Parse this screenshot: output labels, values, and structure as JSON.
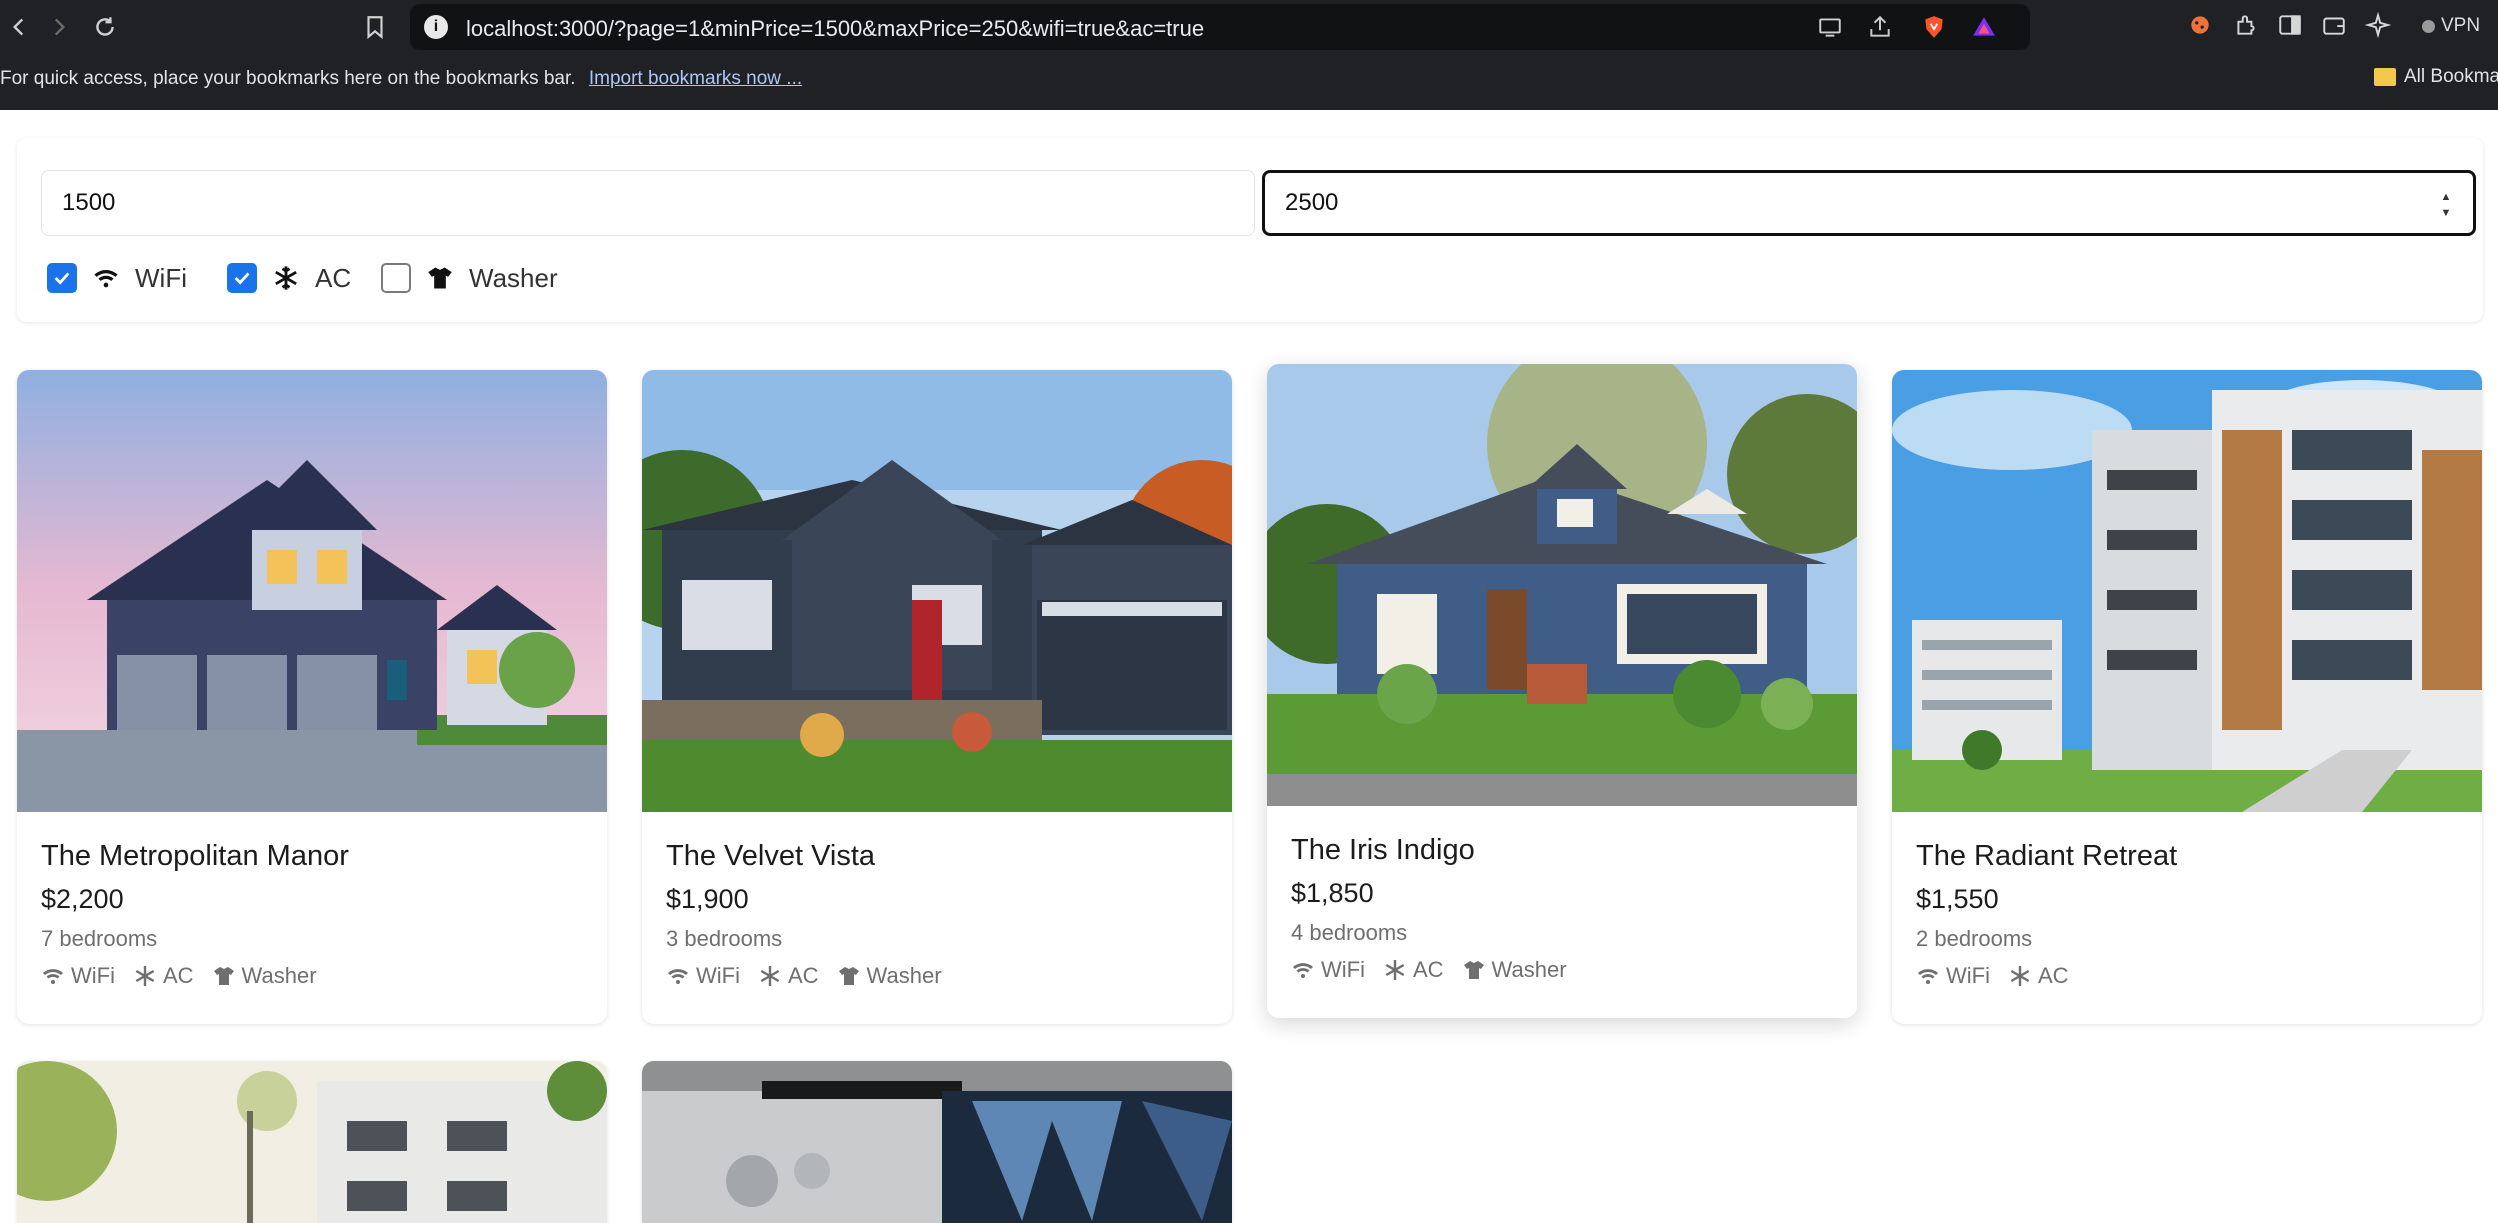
{
  "browser": {
    "url": "localhost:3000/?page=1&minPrice=1500&maxPrice=250&wifi=true&ac=true",
    "vpn_label": "VPN",
    "bookmarks_prompt": "For quick access, place your bookmarks here on the bookmarks bar.",
    "import_link": "Import bookmarks now ...",
    "all_bookmarks": "All Bookma"
  },
  "filters": {
    "min_price": "1500",
    "max_price": "2500",
    "amenities": [
      {
        "label": "WiFi",
        "checked": true,
        "icon": "wifi-icon"
      },
      {
        "label": "AC",
        "checked": true,
        "icon": "snowflake-icon"
      },
      {
        "label": "Washer",
        "checked": false,
        "icon": "shirt-icon"
      }
    ]
  },
  "listings": [
    {
      "title": "The Metropolitan Manor",
      "price": "$2,200",
      "bedrooms": "7 bedrooms",
      "amenities": [
        "WiFi",
        "AC",
        "Washer"
      ],
      "image": "navy two-story house with three-car garage at dusk"
    },
    {
      "title": "The Velvet Vista",
      "price": "$1,900",
      "bedrooms": "3 bedrooms",
      "amenities": [
        "WiFi",
        "AC",
        "Washer"
      ],
      "image": "dark ranch house with red door and garden"
    },
    {
      "title": "The Iris Indigo",
      "price": "$1,850",
      "bedrooms": "4 bedrooms",
      "amenities": [
        "WiFi",
        "AC",
        "Washer"
      ],
      "image": "blue craftsman bungalow with lush front garden"
    },
    {
      "title": "The Radiant Retreat",
      "price": "$1,550",
      "bedrooms": "2 bedrooms",
      "amenities": [
        "WiFi",
        "AC"
      ],
      "image": "modern apartment block with wooden balconies"
    },
    {
      "title": "",
      "price": "",
      "bedrooms": "",
      "amenities": [],
      "image": "white apartment building with trees"
    },
    {
      "title": "",
      "price": "",
      "bedrooms": "",
      "amenities": [],
      "image": "interior with dark artwork wall"
    }
  ],
  "colors": {
    "chrome_bg": "#202124",
    "checkbox_checked": "#1a73e8",
    "muted_text": "#6f6f6f"
  }
}
